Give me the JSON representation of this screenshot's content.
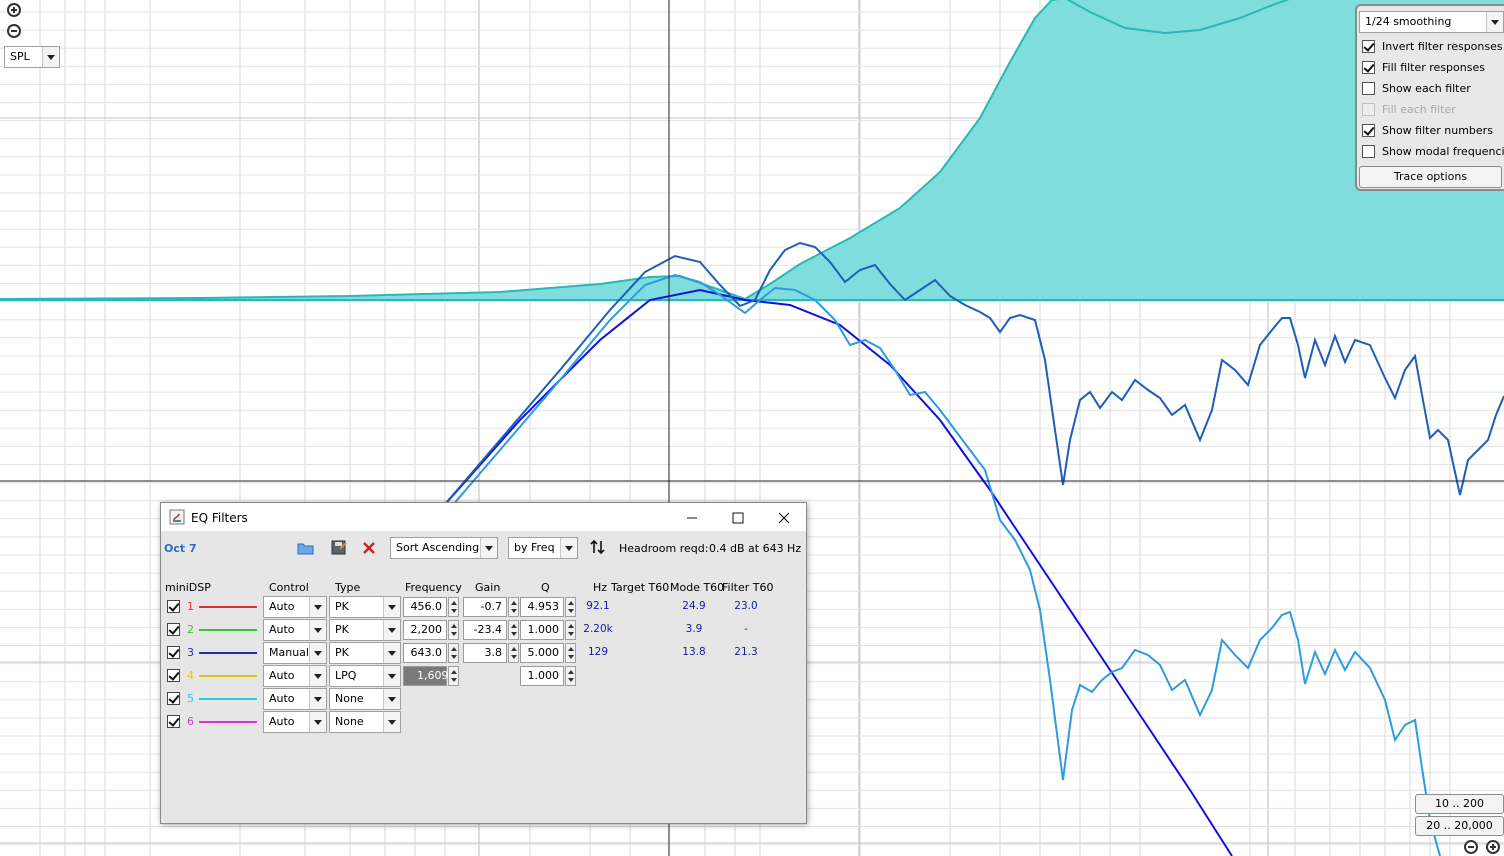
{
  "graph": {
    "trace_select": "SPL",
    "colors": {
      "background": "#ffffff",
      "grid": "#d8d8d8",
      "fill": "#7fdedd",
      "fill_line": "#2ab7b7",
      "measured": "#1d5fb8",
      "predicted": "#2e9be0",
      "target": "#1010e0"
    }
  },
  "options": {
    "smoothing": "1/24 smoothing",
    "items": [
      {
        "label": "Invert filter responses",
        "checked": true,
        "enabled": true
      },
      {
        "label": "Fill filter responses",
        "checked": true,
        "enabled": true
      },
      {
        "label": "Show each filter",
        "checked": false,
        "enabled": true
      },
      {
        "label": "Fill each filter",
        "checked": false,
        "enabled": false
      },
      {
        "label": "Show filter numbers",
        "checked": true,
        "enabled": true
      },
      {
        "label": "Show modal frequencies",
        "checked": false,
        "enabled": true
      }
    ],
    "trace_button": "Trace options"
  },
  "range_buttons": {
    "low": "10 .. 200",
    "full": "20 .. 20,000"
  },
  "dialog": {
    "title": "EQ Filters",
    "filter_set": "Oct 7",
    "sort_order": "Sort Ascending",
    "sort_by": "by Freq",
    "headroom_label": "Headroom reqd:",
    "headroom_value": "0.4 dB at 643 Hz",
    "columns": {
      "equaliser": "miniDSP",
      "control": "Control",
      "type": "Type",
      "frequency": "Frequency",
      "gain": "Gain",
      "q": "Q",
      "hz": "Hz",
      "target_t60": "Target T60",
      "mode_t60": "Mode T60",
      "filter_t60": "Filter T60"
    },
    "filters": [
      {
        "num": "1",
        "color": "#e03030",
        "control": "Auto",
        "type": "PK",
        "freq": "456.0",
        "gain": "-0.7",
        "q": "4.953",
        "hz": "92.1",
        "target_t60": "",
        "mode_t60": "24.9",
        "filter_t60": "23.0"
      },
      {
        "num": "2",
        "color": "#33c433",
        "control": "Auto",
        "type": "PK",
        "freq": "2,200",
        "gain": "-23.4",
        "q": "1.000",
        "hz": "2.20k",
        "target_t60": "",
        "mode_t60": "3.9",
        "filter_t60": "-"
      },
      {
        "num": "3",
        "color": "#2a2ab8",
        "control": "Manual",
        "type": "PK",
        "freq": "643.0",
        "gain": "3.8",
        "q": "5.000",
        "hz": "129",
        "target_t60": "",
        "mode_t60": "13.8",
        "filter_t60": "21.3"
      },
      {
        "num": "4",
        "color": "#d8c81e",
        "control": "Auto",
        "type": "LPQ",
        "freq": "1,609",
        "gain": "",
        "q": "1.000",
        "hz": "",
        "target_t60": "",
        "mode_t60": "",
        "filter_t60": ""
      },
      {
        "num": "5",
        "color": "#2ec8e0",
        "control": "Auto",
        "type": "None",
        "freq": "",
        "gain": "",
        "q": "",
        "hz": "",
        "target_t60": "",
        "mode_t60": "",
        "filter_t60": ""
      },
      {
        "num": "6",
        "color": "#d038d0",
        "control": "Auto",
        "type": "None",
        "freq": "",
        "gain": "",
        "q": "",
        "hz": "",
        "target_t60": "",
        "mode_t60": "",
        "filter_t60": ""
      }
    ]
  }
}
